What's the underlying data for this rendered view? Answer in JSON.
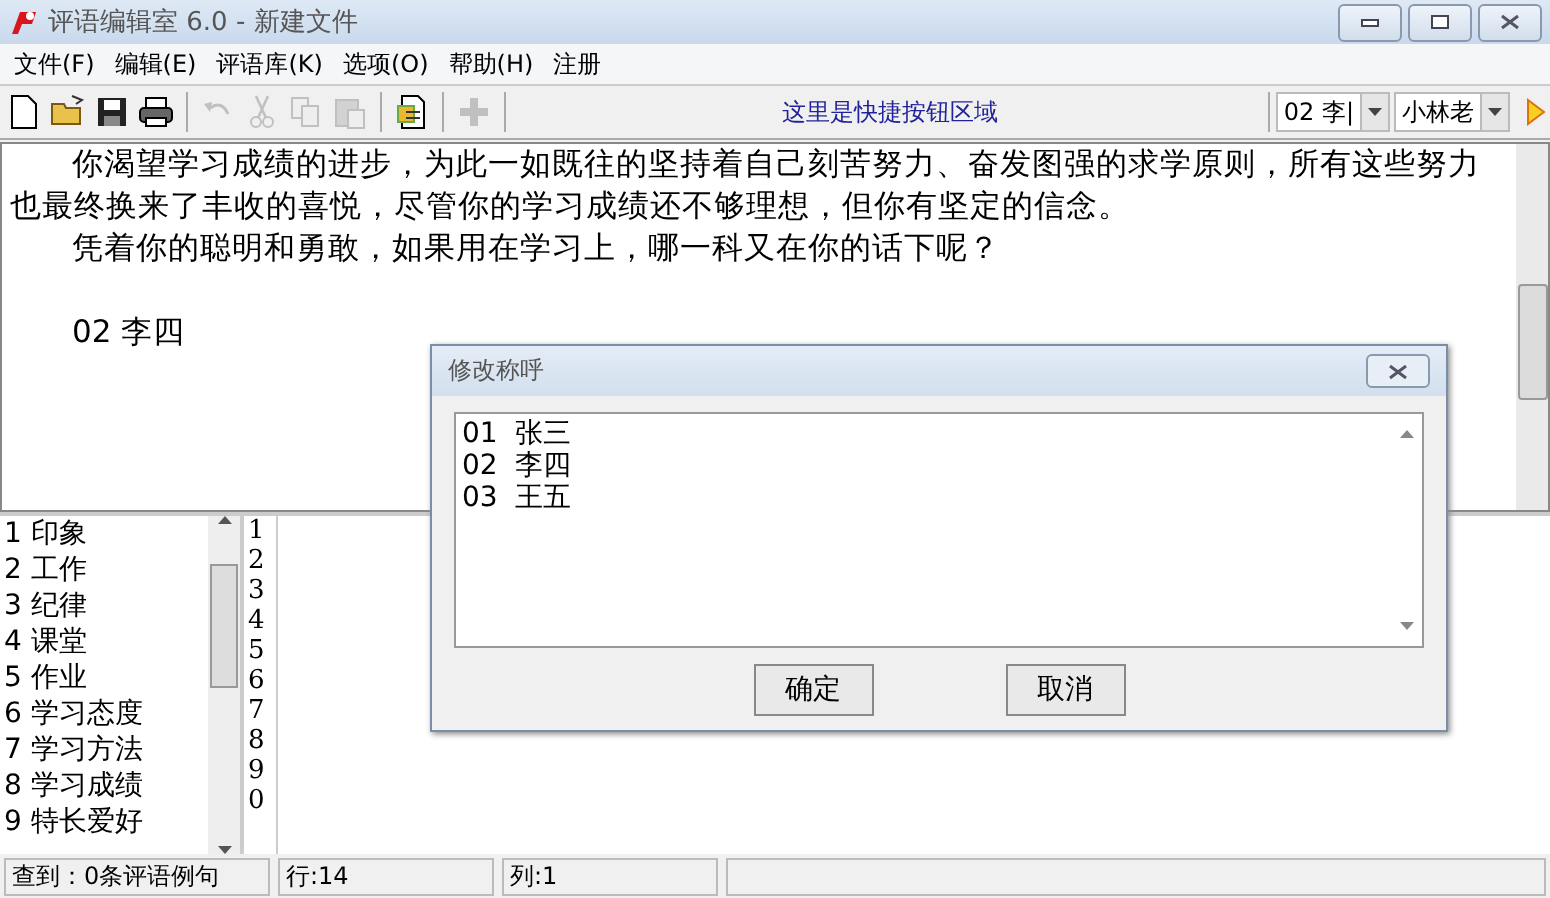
{
  "window": {
    "title": "评语编辑室 6.0 - 新建文件"
  },
  "menu": [
    {
      "label": "文件(F)"
    },
    {
      "label": "编辑(E)"
    },
    {
      "label": "评语库(K)"
    },
    {
      "label": "选项(O)"
    },
    {
      "label": "帮助(H)"
    },
    {
      "label": "注册"
    }
  ],
  "toolbar": {
    "buttons": [
      {
        "kind": "new",
        "disabled": false
      },
      {
        "kind": "open",
        "disabled": false
      },
      {
        "kind": "save",
        "disabled": false
      },
      {
        "kind": "print",
        "disabled": false
      },
      {
        "kind": "sep"
      },
      {
        "kind": "undo",
        "disabled": true
      },
      {
        "kind": "cut",
        "disabled": true
      },
      {
        "kind": "copy",
        "disabled": true
      },
      {
        "kind": "paste",
        "disabled": true
      },
      {
        "kind": "sep"
      },
      {
        "kind": "document",
        "disabled": false
      },
      {
        "kind": "sep"
      },
      {
        "kind": "add",
        "disabled": true
      },
      {
        "kind": "sep"
      }
    ],
    "hint": "这里是快捷按钮区域",
    "combos": [
      {
        "value": "02 李|"
      },
      {
        "value": "小林老"
      }
    ]
  },
  "editor": {
    "paragraphs": [
      {
        "text": "你渴望学习成绩的进步，为此一如既往的坚持着自己刻苦努力、奋发图强的求学原则，所有这些努力也最终换来了丰收的喜悦，尽管你的学习成绩还不够理想，但你有坚定的信念。",
        "gap_before": false
      },
      {
        "text": "凭着你的聪明和勇敢，如果用在学习上，哪一科又在你的话下呢？",
        "gap_before": false
      },
      {
        "text": "02 李四",
        "gap_before": true
      }
    ]
  },
  "categories": [
    {
      "number": "1",
      "label": "印象"
    },
    {
      "number": "2",
      "label": "工作"
    },
    {
      "number": "3",
      "label": "纪律"
    },
    {
      "number": "4",
      "label": "课堂"
    },
    {
      "number": "5",
      "label": "作业"
    },
    {
      "number": "6",
      "label": "学习态度"
    },
    {
      "number": "7",
      "label": "学习方法"
    },
    {
      "number": "8",
      "label": "学习成绩"
    },
    {
      "number": "9",
      "label": "特长爱好"
    }
  ],
  "line_numbers": [
    "1",
    "2",
    "3",
    "4",
    "5",
    "6",
    "7",
    "8",
    "9",
    "0"
  ],
  "status_bar": [
    "查到：0条评语例句",
    "行:14",
    "列:1"
  ],
  "dialog": {
    "title": "修改称呼",
    "items": [
      "01  张三",
      "02  李四",
      "03  王五"
    ],
    "buttons": [
      "确定",
      "取消"
    ]
  }
}
